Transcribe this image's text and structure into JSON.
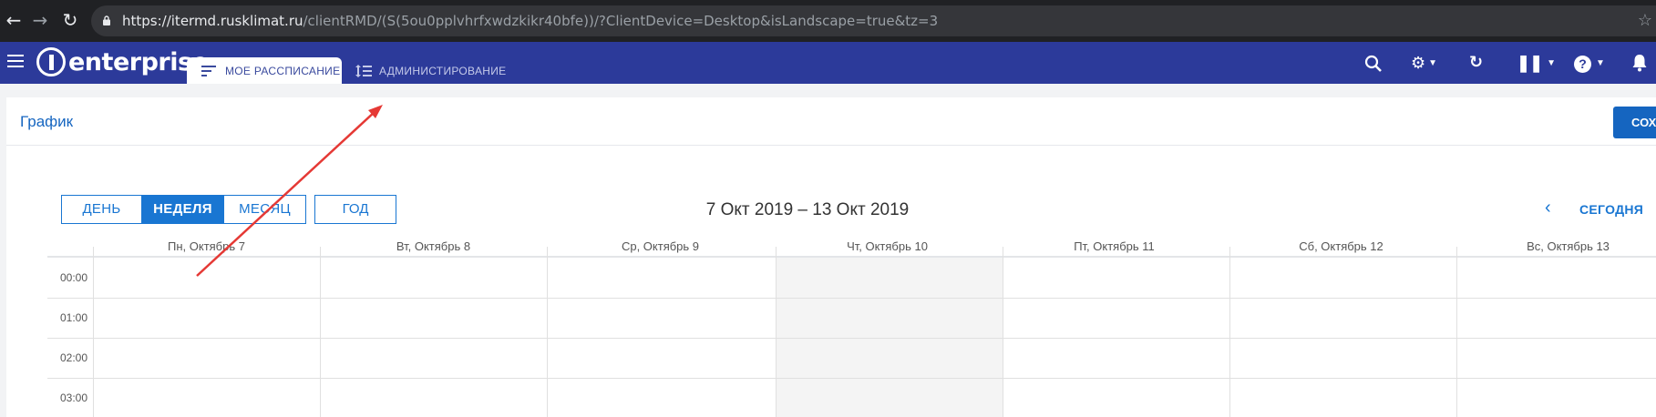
{
  "browser": {
    "url_host": "https://itermd.rusklimat.ru",
    "url_path": "/clientRMD/(S(5ou0pplvhrfxwdzkikr40bfe))/?ClientDevice=Desktop&isLandscape=true&tz=3"
  },
  "app": {
    "logo_text": "enterprise",
    "tabs": [
      {
        "label": "МОЕ РАССПИСАНИЕ",
        "active": true
      },
      {
        "label": "АДМИНИСТИРОВАНИЕ",
        "active": false
      }
    ]
  },
  "page": {
    "title": "График",
    "save_label": "СОХ"
  },
  "calendar": {
    "views": [
      {
        "label": "ДЕНЬ",
        "active": false
      },
      {
        "label": "НЕДЕЛЯ",
        "active": true
      },
      {
        "label": "МЕСЯЦ",
        "active": false
      }
    ],
    "year_label": "ГОД",
    "date_range": "7 Окт 2019 – 13 Окт 2019",
    "today_label": "СЕГОДНЯ",
    "days": [
      "Пн, Октябрь 7",
      "Вт, Октябрь 8",
      "Ср, Октябрь 9",
      "Чт, Октябрь 10",
      "Пт, Октябрь 11",
      "Сб, Октябрь 12",
      "Вс, Октябрь 13"
    ],
    "highlighted_day": "Чт, Октябрь 10",
    "times": [
      "00:00",
      "01:00",
      "02:00",
      "03:00"
    ]
  },
  "colors": {
    "header_bg": "#2c3a9a",
    "accent": "#1976d2",
    "annotation_arrow": "#e53935"
  }
}
